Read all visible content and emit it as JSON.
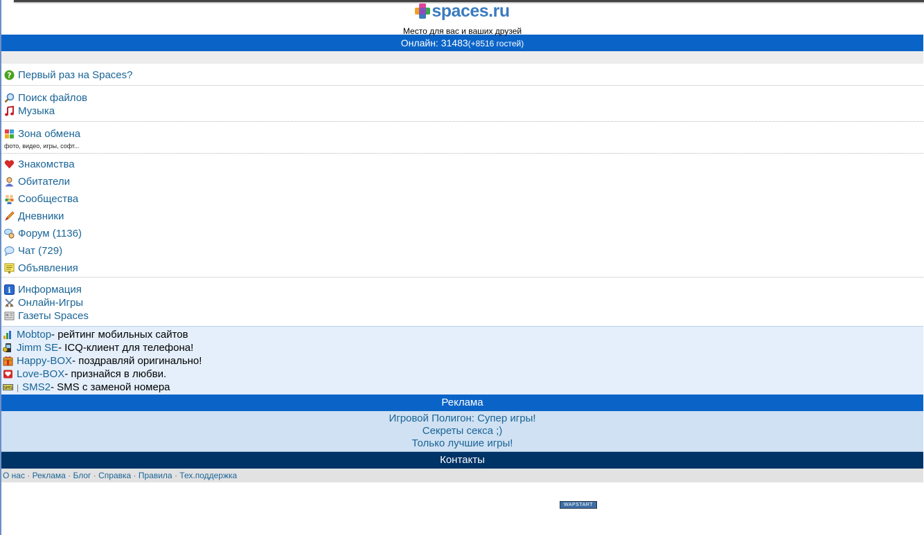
{
  "header": {
    "logo_text": "spaces.ru",
    "tagline": "Место для вас и ваших друзей"
  },
  "online": {
    "label": "Онлайн: 31483",
    "guests": "(+8516 гостей)"
  },
  "first_time": {
    "label": "Первый раз на Spaces?",
    "icon": "question-icon"
  },
  "group1": [
    {
      "label": "Поиск файлов",
      "icon": "magnifier-icon"
    },
    {
      "label": "Музыка",
      "icon": "music-note-icon"
    }
  ],
  "exchange": {
    "label": "Зона обмена",
    "icon": "grid-icon",
    "sub": "фото, видео, игры, софт..."
  },
  "group2": [
    {
      "label": "Знакомства",
      "icon": "heart-icon"
    },
    {
      "label": "Обитатели",
      "icon": "user-icon"
    },
    {
      "label": "Сообщества",
      "icon": "users-icon"
    },
    {
      "label": "Дневники",
      "icon": "pencil-icon"
    },
    {
      "label": "Форум (1136)",
      "icon": "forum-icon"
    },
    {
      "label": "Чат (729)",
      "icon": "chat-icon"
    },
    {
      "label": "Объявления",
      "icon": "notice-icon"
    }
  ],
  "group3": [
    {
      "label": "Информация",
      "icon": "info-icon"
    },
    {
      "label": "Онлайн-Игры",
      "icon": "swords-icon"
    },
    {
      "label": "Газеты Spaces",
      "icon": "newspaper-icon"
    }
  ],
  "promo": [
    {
      "link": "Mobtop",
      "text": " - рейтинг мобильных сайтов",
      "icon": "bar-chart-icon"
    },
    {
      "link": "Jimm SE",
      "text": " - ICQ-клиент для телефона!",
      "icon": "phone-app-icon"
    },
    {
      "link": "Happy-BOX",
      "text": " - поздравляй оригинально!",
      "icon": "gift-icon"
    },
    {
      "link": "Love-BOX",
      "text": " - признайся в любви.",
      "icon": "love-box-icon"
    },
    {
      "link": "SMS2",
      "text": " - SMS с заменой номера",
      "icon": "sms-icon",
      "pre": "|"
    }
  ],
  "ads": {
    "title": "Реклама",
    "items": [
      "Игровой Полигон: Супер игры!",
      "Секреты секса ;)",
      "Только лучшие игры!"
    ]
  },
  "contacts": {
    "title": "Контакты",
    "links": [
      "О нас",
      "Реклама",
      "Блог",
      "Справка",
      "Правила",
      "Тех.поддержка"
    ],
    "separator": "·"
  },
  "counter_label": "WAPSTART"
}
